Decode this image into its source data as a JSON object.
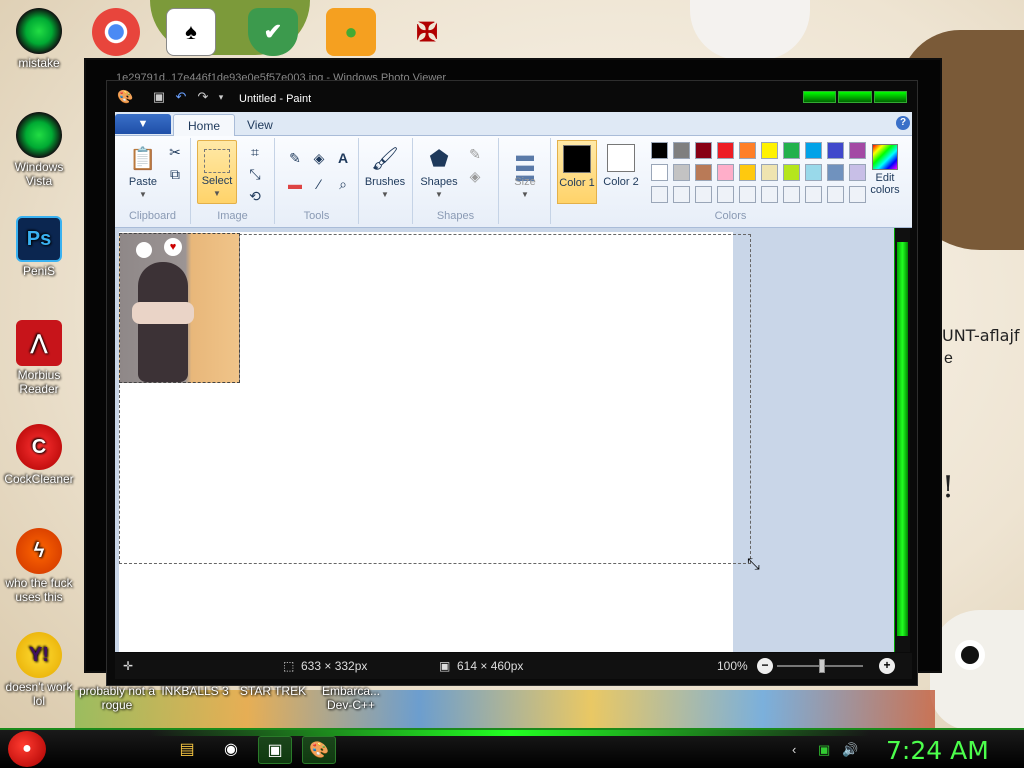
{
  "desktop": {
    "icons": [
      {
        "label": "mistake",
        "icon": "green-orb-icon"
      },
      {
        "label": "Windows Vista",
        "icon": "green-orb-icon"
      },
      {
        "label": "PeniS",
        "icon": "photoshop-icon",
        "glyph": "Ps"
      },
      {
        "label": "Morbius Reader",
        "icon": "pdf-reader-icon"
      },
      {
        "label": "CockCleaner",
        "icon": "ccleaner-icon"
      },
      {
        "label": "who the fuck uses this",
        "icon": "flash-icon"
      },
      {
        "label": "doesn't work lol",
        "icon": "yahoo-messenger-icon"
      }
    ],
    "bottom_labels": [
      "probably not a rogue",
      "INKBALLS 3",
      "STAR TREK",
      "Embarca... Dev-C++"
    ],
    "wallpaper_text": [
      "UNT-aflajf",
      "e",
      "!"
    ]
  },
  "background_window": {
    "title": "1e29791d..17e446f1de93e0e5f57e003.jpg - Windows Photo Viewer"
  },
  "paint": {
    "title": "Untitled - Paint",
    "tabs": {
      "file": "▼",
      "home": "Home",
      "view": "View"
    },
    "groups": {
      "clipboard": "Clipboard",
      "image": "Image",
      "tools": "Tools",
      "shapes": "Shapes",
      "colors": "Colors"
    },
    "buttons": {
      "paste": "Paste",
      "select": "Select",
      "brushes": "Brushes",
      "shapes": "Shapes",
      "size": "Size",
      "color1": "Color 1",
      "color2": "Color 2",
      "edit_colors": "Edit colors"
    },
    "color1": "#000000",
    "color2": "#ffffff",
    "palette_row1": [
      "#000000",
      "#7f7f7f",
      "#880015",
      "#ed1c24",
      "#ff7f27",
      "#fff200",
      "#22b14c",
      "#00a2e8",
      "#3f48cc",
      "#a349a4"
    ],
    "palette_row2": [
      "#ffffff",
      "#c3c3c3",
      "#b97a57",
      "#ffaec9",
      "#ffc90e",
      "#efe4b0",
      "#b5e61d",
      "#99d9ea",
      "#7092be",
      "#c8bfe7"
    ],
    "status": {
      "selection_size": "633 × 332px",
      "canvas_size": "614 × 460px",
      "zoom": "100%"
    }
  },
  "taskbar": {
    "clock": "7:24 AM"
  },
  "colors": {
    "accent_green": "#22b14c",
    "clock_green": "#4cff4c"
  }
}
